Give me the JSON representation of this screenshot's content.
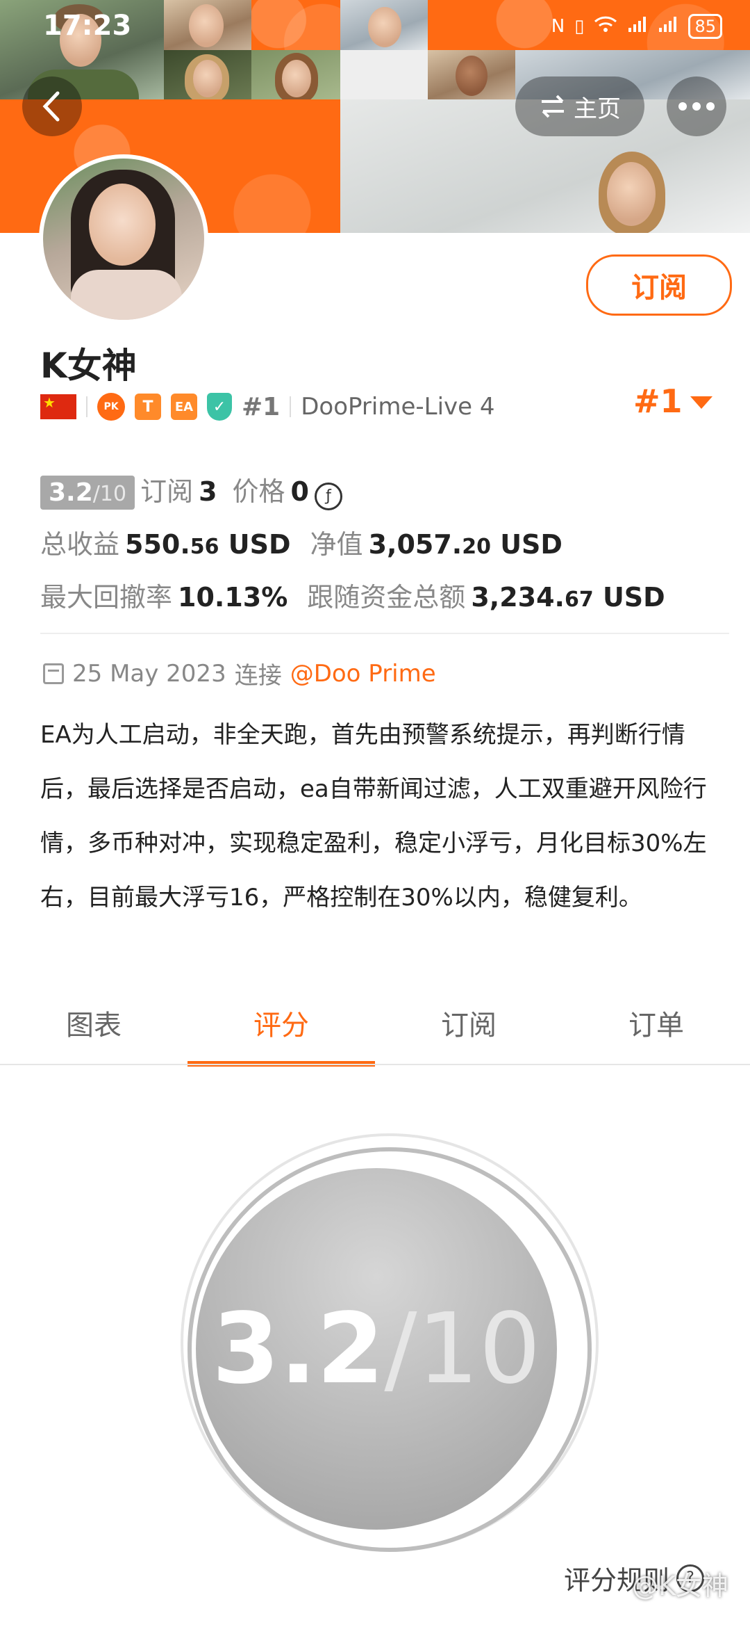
{
  "status_bar": {
    "time": "17:23",
    "battery": "85"
  },
  "header": {
    "home_label": "主页"
  },
  "profile": {
    "name": "K女神",
    "subscribe_label": "订阅",
    "badges": {
      "pk": "PK",
      "t": "T",
      "ea": "EA",
      "rank": "#1",
      "server": "DooPrime-Live 4"
    },
    "rank_big": "#1"
  },
  "stats": {
    "score": "3.2",
    "score_den": "/10",
    "subscribe_label": "订阅",
    "subscribe_count": "3",
    "price_label": "价格",
    "price_value": "0",
    "total_profit_label": "总收益",
    "total_profit_int": "550.",
    "total_profit_dec": "56",
    "currency": "USD",
    "net_value_label": "净值",
    "net_value_int": "3,057.",
    "net_value_dec": "20",
    "max_drawdown_label": "最大回撤率",
    "max_drawdown_value": "10.13%",
    "follow_total_label": "跟随资金总额",
    "follow_total_int": "3,234.",
    "follow_total_dec": "67"
  },
  "info": {
    "date": "25 May 2023",
    "connect_label": "连接",
    "broker": "@Doo Prime",
    "description": "EA为人工启动，非全天跑，首先由预警系统提示，再判断行情后，最后选择是否启动，ea自带新闻过滤，人工双重避开风险行情，多币种对冲，实现稳定盈利，稳定小浮亏，月化目标30%左右，目前最大浮亏16，严格控制在30%以内，稳健复利。"
  },
  "tabs": [
    "图表",
    "评分",
    "订阅",
    "订单"
  ],
  "score_panel": {
    "value": "3.2",
    "den": "/10",
    "rules_label": "评分规则"
  },
  "watermark": "@K女神",
  "colors": {
    "accent": "#ff6a13",
    "score_gray": "#a8a8a8"
  },
  "icons": {
    "back": "chevron-left-icon",
    "swap": "swap-icon",
    "more": "more-icon",
    "calendar": "calendar-icon",
    "help": "question-icon"
  }
}
